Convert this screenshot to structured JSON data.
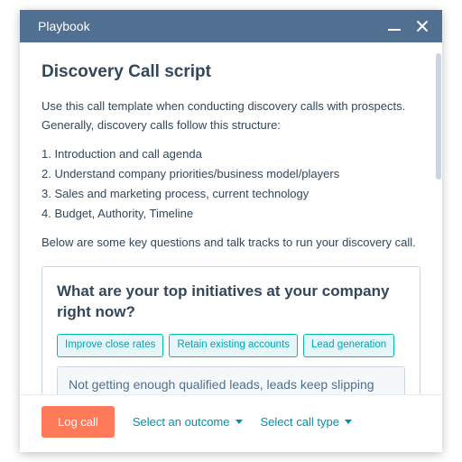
{
  "titlebar": {
    "title": "Playbook"
  },
  "page": {
    "heading": "Discovery Call script",
    "intro": "Use this call template when conducting discovery calls with prospects. Generally, discovery calls follow this structure:",
    "steps": [
      "1. Introduction and call agenda",
      "2. Understand company priorities/business model/players",
      "3. Sales and marketing process, current technology",
      "4. Budget, Authority, Timeline"
    ],
    "below": "Below are some key questions and talk tracks to run your discovery call."
  },
  "question_card": {
    "prompt": "What are your top initiatives at your company right now?",
    "chips": [
      "Improve close rates",
      "Retain existing accounts",
      "Lead generation"
    ],
    "answer_value": "Not getting enough qualified leads, leads keep slipping through the cracks"
  },
  "footer": {
    "log_label": "Log call",
    "outcome_label": "Select an outcome",
    "calltype_label": "Select call type"
  }
}
